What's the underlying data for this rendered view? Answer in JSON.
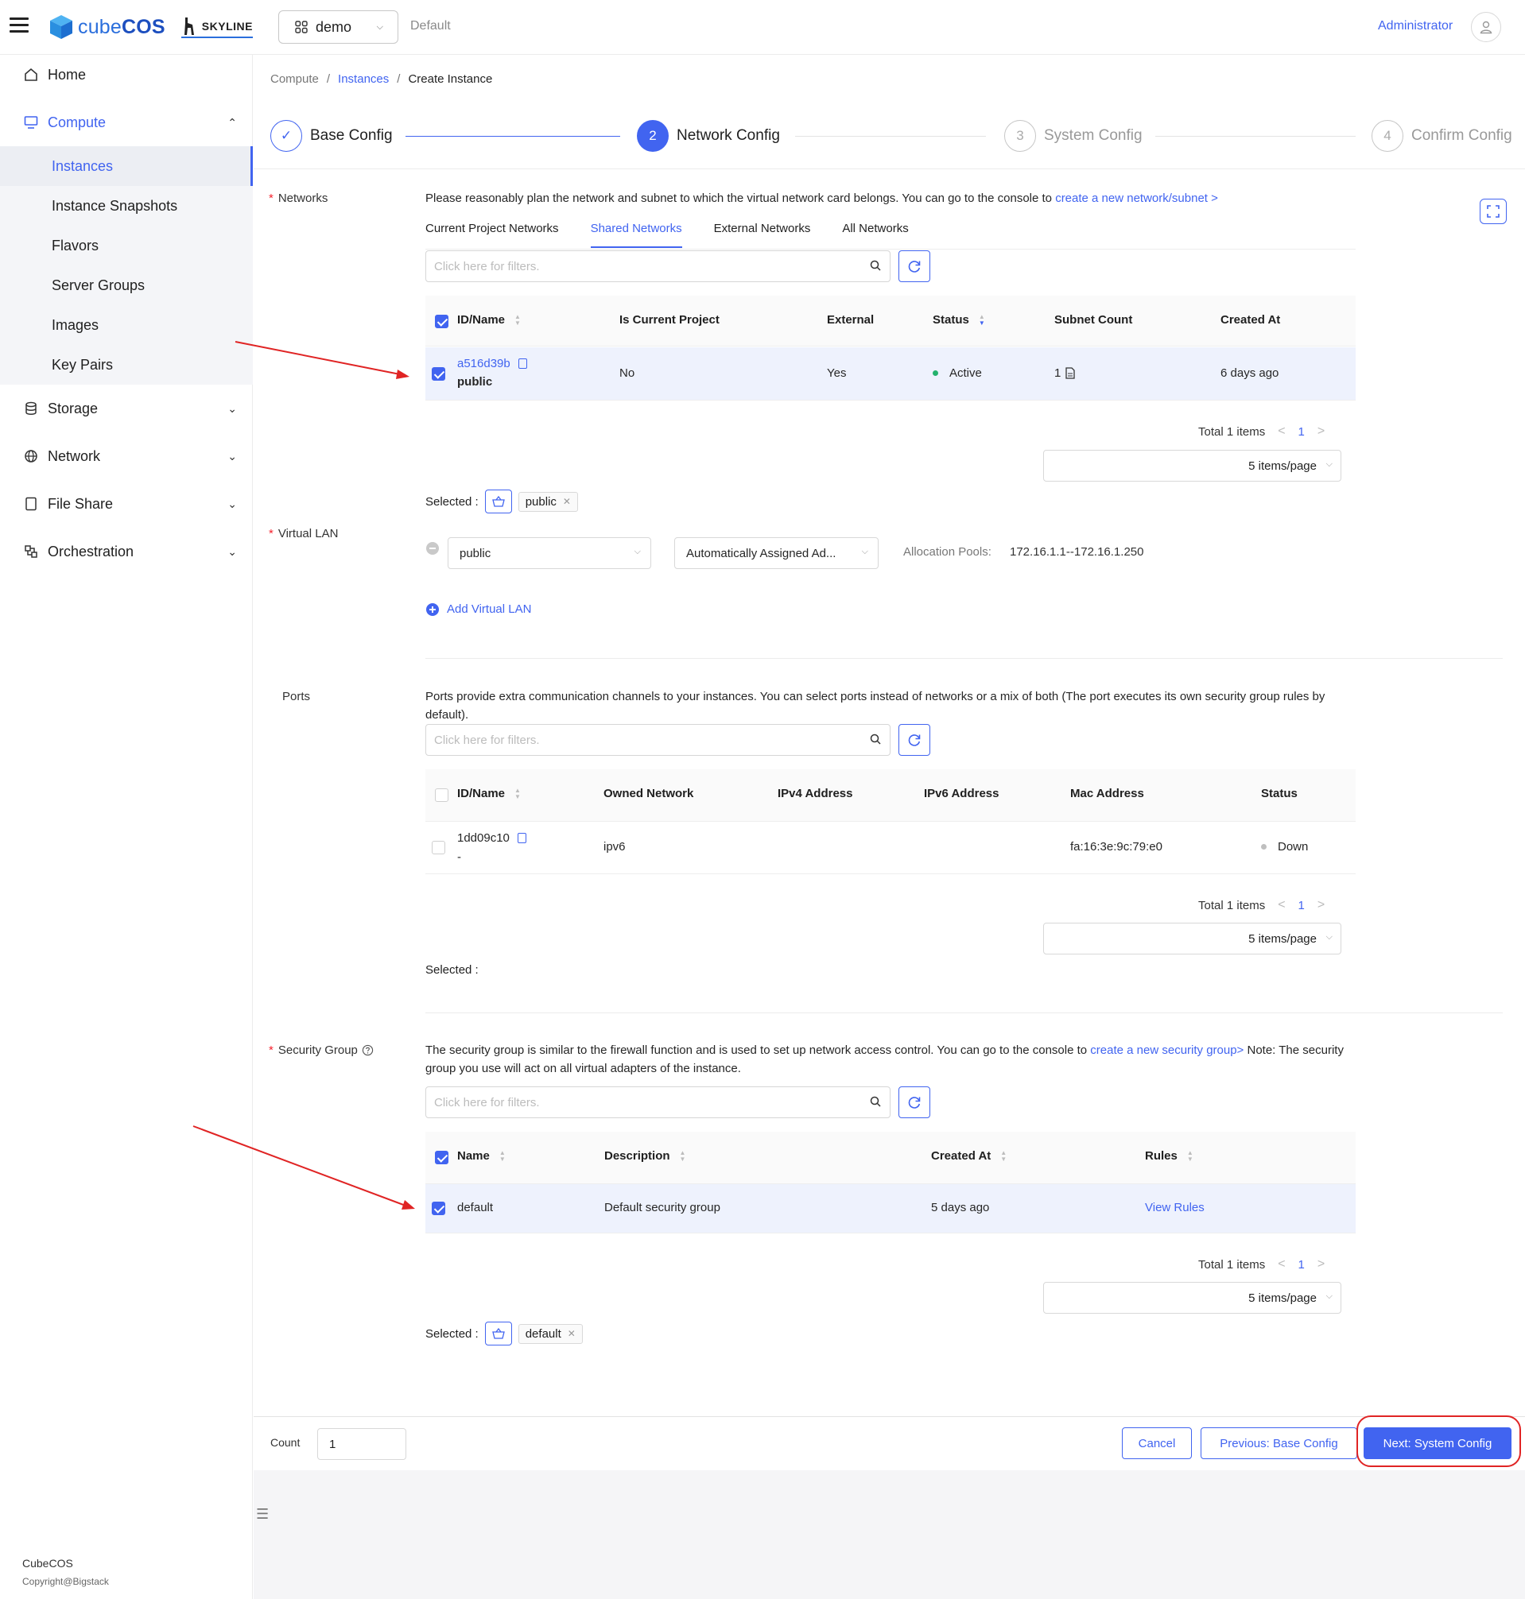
{
  "header": {
    "brand": "cube",
    "brand_bold": "COS",
    "skyline": "SKYLINE",
    "project": "demo",
    "domain": "Default",
    "user": "Administrator"
  },
  "sidebar": {
    "home": "Home",
    "compute": "Compute",
    "compute_items": [
      "Instances",
      "Instance Snapshots",
      "Flavors",
      "Server Groups",
      "Images",
      "Key Pairs"
    ],
    "storage": "Storage",
    "network": "Network",
    "file_share": "File Share",
    "orchestration": "Orchestration",
    "footer_title": "CubeCOS",
    "footer_copy": "Copyright@Bigstack"
  },
  "breadcrumb": {
    "a": "Compute",
    "sep": "/",
    "b": "Instances",
    "c": "Create Instance"
  },
  "steps": [
    {
      "num": "✓",
      "label": "Base Config"
    },
    {
      "num": "2",
      "label": "Network Config"
    },
    {
      "num": "3",
      "label": "System Config"
    },
    {
      "num": "4",
      "label": "Confirm Config"
    }
  ],
  "networks": {
    "label": "Networks",
    "desc": "Please reasonably plan the network and subnet to which the virtual network card belongs. You can go to the console to",
    "desc_link": "create a new network/subnet >",
    "tabs": [
      "Current Project Networks",
      "Shared Networks",
      "External Networks",
      "All Networks"
    ],
    "search_placeholder": "Click here for filters.",
    "columns": [
      "ID/Name",
      "Is Current Project",
      "External",
      "Status",
      "Subnet Count",
      "Created At"
    ],
    "row": {
      "id": "a516d39b",
      "name": "public",
      "current": "No",
      "external": "Yes",
      "status": "Active",
      "subnets": "1",
      "created": "6 days ago"
    },
    "total": "Total 1 items",
    "page": "1",
    "page_size": "5 items/page",
    "selected_label": "Selected :",
    "selected_tag": "public"
  },
  "vlan": {
    "label": "Virtual LAN",
    "network": "public",
    "assign": "Automatically Assigned Ad...",
    "pools_label": "Allocation Pools:",
    "pools": "172.16.1.1--172.16.1.250",
    "add": "Add Virtual LAN"
  },
  "ports": {
    "label": "Ports",
    "desc": "Ports provide extra communication channels to your instances. You can select ports instead of networks or a mix of both (The port executes its own security group rules by default).",
    "search_placeholder": "Click here for filters.",
    "columns": [
      "ID/Name",
      "Owned Network",
      "IPv4 Address",
      "IPv6 Address",
      "Mac Address",
      "Status"
    ],
    "row": {
      "id": "1dd09c10",
      "name": "-",
      "network": "ipv6",
      "mac": "fa:16:3e:9c:79:e0",
      "status": "Down"
    },
    "total": "Total 1 items",
    "page": "1",
    "page_size": "5 items/page",
    "selected_label": "Selected :"
  },
  "secgroup": {
    "label": "Security Group",
    "desc_a": "The security group is similar to the firewall function and is used to set up network access control. You can go to the console to",
    "desc_link": "create a new security group>",
    "desc_b": "Note: The security group you use will act on all virtual adapters of the instance.",
    "search_placeholder": "Click here for filters.",
    "columns": [
      "Name",
      "Description",
      "Created At",
      "Rules"
    ],
    "row": {
      "name": "default",
      "desc": "Default security group",
      "created": "5 days ago",
      "rules": "View Rules"
    },
    "total": "Total 1 items",
    "page": "1",
    "page_size": "5 items/page",
    "selected_label": "Selected :",
    "selected_tag": "default"
  },
  "footer": {
    "count_label": "Count",
    "count": "1",
    "cancel": "Cancel",
    "prev": "Previous: Base Config",
    "next": "Next: System Config"
  },
  "colors": {
    "accent": "#4164f0",
    "annotation": "#e02424",
    "active_status": "#23b26d",
    "down_status": "#bfbfbf"
  }
}
